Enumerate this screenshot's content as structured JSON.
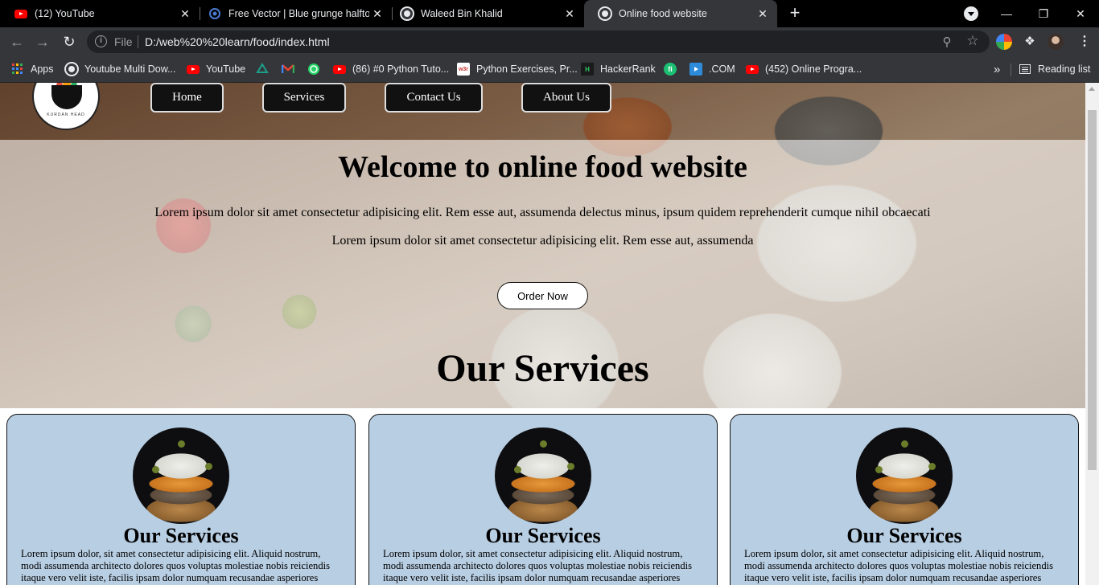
{
  "browser": {
    "tabs": [
      {
        "title": "(12) YouTube",
        "icon": "youtube-icon",
        "active": false
      },
      {
        "title": "Free Vector | Blue grunge halfton",
        "icon": "freepik-icon",
        "active": false
      },
      {
        "title": "Waleed Bin Khalid",
        "icon": "globe-icon",
        "active": false
      },
      {
        "title": "Online food website",
        "icon": "globe-icon",
        "active": true
      }
    ],
    "close_glyph": "✕",
    "new_tab_glyph": "+",
    "address": {
      "scheme_label": "File",
      "url": "D:/web%20%20learn/food/index.html"
    },
    "bookmarks": [
      {
        "label": "Apps",
        "icon": "apps-grid-icon"
      },
      {
        "label": "Youtube Multi Dow...",
        "icon": "globe-icon"
      },
      {
        "label": "YouTube",
        "icon": "youtube-icon"
      },
      {
        "label": "",
        "icon": "gitkraken-icon"
      },
      {
        "label": "",
        "icon": "gmail-icon"
      },
      {
        "label": "",
        "icon": "whatsapp-icon"
      },
      {
        "label": "(86) #0 Python Tuto...",
        "icon": "youtube-icon"
      },
      {
        "label": "Python Exercises, Pr...",
        "icon": "w3resource-icon"
      },
      {
        "label": "HackerRank",
        "icon": "hackerrank-icon"
      },
      {
        "label": "",
        "icon": "fiverr-icon"
      },
      {
        "label": ".COM",
        "icon": "video-icon"
      },
      {
        "label": "(452) Online Progra...",
        "icon": "youtube-icon"
      }
    ],
    "more_bookmarks_glyph": "»",
    "reading_list_label": "Reading list"
  },
  "site": {
    "logo_text": "KURDAN HEAD",
    "nav": [
      {
        "label": "Home"
      },
      {
        "label": "Services"
      },
      {
        "label": "Contact Us"
      },
      {
        "label": "About Us"
      }
    ],
    "hero": {
      "title": "Welcome to online food website",
      "paragraph1": "Lorem ipsum dolor sit amet consectetur adipisicing elit. Rem esse aut, assumenda delectus minus, ipsum quidem reprehenderit cumque nihil obcaecati",
      "paragraph2": "Lorem ipsum dolor sit amet consectetur adipisicing elit. Rem esse aut, assumenda",
      "cta": "Order Now"
    },
    "services_heading": "Our Services",
    "cards": [
      {
        "title": "Our Services",
        "text": "Lorem ipsum dolor, sit amet consectetur adipisicing elit. Aliquid nostrum, modi assumenda architecto dolores quos voluptas molestiae nobis reiciendis itaque vero velit iste, facilis ipsam dolor numquam recusandae asperiores"
      },
      {
        "title": "Our Services",
        "text": "Lorem ipsum dolor, sit amet consectetur adipisicing elit. Aliquid nostrum, modi assumenda architecto dolores quos voluptas molestiae nobis reiciendis itaque vero velit iste, facilis ipsam dolor numquam recusandae asperiores"
      },
      {
        "title": "Our Services",
        "text": "Lorem ipsum dolor, sit amet consectetur adipisicing elit. Aliquid nostrum, modi assumenda architecto dolores quos voluptas molestiae nobis reiciendis itaque vero velit iste, facilis ipsam dolor numquam recusandae asperiores"
      }
    ]
  },
  "colors": {
    "card_bg": "#b8cee3",
    "nav_bg": "#111111",
    "chrome_dark": "#35363a"
  }
}
